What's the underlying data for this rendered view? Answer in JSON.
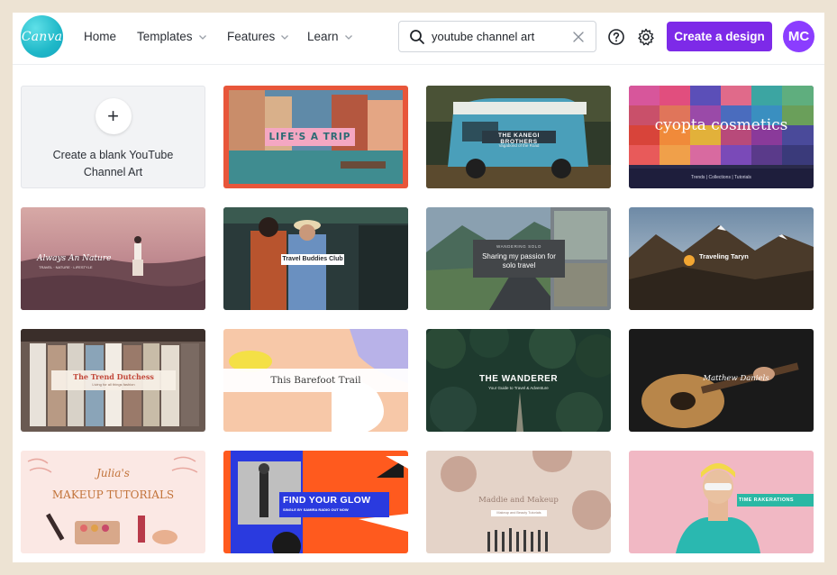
{
  "app": {
    "logo_text": "Canva"
  },
  "nav": [
    {
      "label": "Home",
      "dropdown": false
    },
    {
      "label": "Templates",
      "dropdown": true
    },
    {
      "label": "Features",
      "dropdown": true
    },
    {
      "label": "Learn",
      "dropdown": true
    }
  ],
  "search": {
    "value": "youtube channel art",
    "placeholder": "Search"
  },
  "header": {
    "create_label": "Create a design",
    "avatar_initials": "MC"
  },
  "colors": {
    "accent": "#7d2ae8",
    "logo": "#20c4cb",
    "page_bg": "#ede3d3"
  },
  "blank_card": {
    "label": "Create a blank YouTube Channel Art",
    "plus": "+"
  },
  "templates": [
    {
      "text": "LIFE'S A TRIP"
    },
    {
      "text": "THE KANEGI BROTHERS",
      "sub": "Vagabond of the Road"
    },
    {
      "text": "cyopta cosmetics",
      "sub": "Trends | Collections | Tutorials"
    },
    {
      "text": "Always An Nature",
      "sub": "TRAVEL · NATURE · LIFESTYLE"
    },
    {
      "text": "Travel Buddies Club"
    },
    {
      "text": "Sharing my passion for solo travel",
      "sub": "WANDERING SOLO"
    },
    {
      "text": "Traveling Taryn"
    },
    {
      "text": "The Trend Dutchess",
      "sub": "Living for all things fashion"
    },
    {
      "text": "This Barefoot Trail"
    },
    {
      "text": "THE WANDERER",
      "sub": "Your Guide to Travel & Adventure"
    },
    {
      "text": "Matthew Daniels"
    },
    {
      "text": "Julia's",
      "sub": "MAKEUP TUTORIALS"
    },
    {
      "text": "FIND YOUR GLOW",
      "sub": "SINGLE BY SAMIRA RADIO OUT NOW"
    },
    {
      "text": "Maddie and Makeup",
      "sub": "Makeup and Beauty Tutorials"
    },
    {
      "text": "TIME RAKERATIONS"
    }
  ]
}
